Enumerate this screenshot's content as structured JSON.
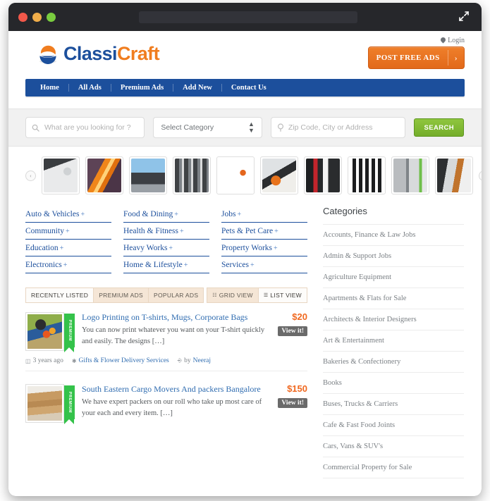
{
  "browser": {
    "traffic_lights": [
      "close",
      "minimize",
      "maximize"
    ],
    "url_value": "",
    "expand_icon": "expand-icon"
  },
  "header": {
    "login_label": "Login",
    "logo_part1": "Classi",
    "logo_part2": "Craft",
    "post_button_label": "POST FREE ADS",
    "post_button_chevron": "›",
    "brand_blue": "#1c4f9c",
    "brand_orange": "#f07d1f"
  },
  "nav": {
    "items": [
      {
        "label": "Home"
      },
      {
        "label": "All Ads"
      },
      {
        "label": "Premium Ads"
      },
      {
        "label": "Add New"
      },
      {
        "label": "Contact Us"
      }
    ]
  },
  "search": {
    "keyword_placeholder": "What are you looking for ?",
    "keyword_value": "",
    "category_selected": "Select Category",
    "location_placeholder": "Zip Code, City or Address",
    "location_value": "",
    "search_button_label": "SEARCH",
    "search_button_color": "#8fc63e"
  },
  "carousel": {
    "prev_label": "‹",
    "next_label": "›",
    "thumbs": [
      {
        "name": "fan-heater"
      },
      {
        "name": "infrared-heater"
      },
      {
        "name": "solar-water-heater"
      },
      {
        "name": "water-storage-tanks"
      },
      {
        "name": "wall-mounted-heater"
      },
      {
        "name": "kitchen-appliance-mixer"
      },
      {
        "name": "blender-food-processor"
      },
      {
        "name": "small-appliances-set"
      },
      {
        "name": "refrigerators"
      },
      {
        "name": "appliance-store"
      }
    ]
  },
  "category_links": [
    {
      "label": "Auto & Vehicles",
      "plus": "+"
    },
    {
      "label": "Food & Dining",
      "plus": "+"
    },
    {
      "label": "Jobs",
      "plus": "+"
    },
    {
      "label": "Community",
      "plus": "+"
    },
    {
      "label": "Health & Fitness",
      "plus": "+"
    },
    {
      "label": "Pets & Pet Care",
      "plus": "+"
    },
    {
      "label": "Education",
      "plus": "+"
    },
    {
      "label": "Heavy Works",
      "plus": "+"
    },
    {
      "label": "Property Works",
      "plus": "+"
    },
    {
      "label": "Electronics",
      "plus": "+"
    },
    {
      "label": "Home & Lifestyle",
      "plus": "+"
    },
    {
      "label": "Services",
      "plus": "+"
    }
  ],
  "tabs": [
    {
      "label": "RECENTLY LISTED",
      "active": true
    },
    {
      "label": "PREMIUM ADS",
      "active": false
    },
    {
      "label": "POPULAR ADS",
      "active": false
    }
  ],
  "views": [
    {
      "label": "GRID VIEW",
      "active": false,
      "glyph": "☷"
    },
    {
      "label": "LIST VIEW",
      "active": true,
      "glyph": "☰"
    }
  ],
  "listings": [
    {
      "badge": "PREMIUM",
      "title": "Logo Printing on T-shirts, Mugs, Corporate Bags",
      "description": "You can now print whatever you want on your T-shirt quickly and easily. The designs […]",
      "price": "$20",
      "view_label": "View it!",
      "time_ago": "3 years ago",
      "category": "Gifts & Flower Delivery Services",
      "author_prefix": "by",
      "author": "Neeraj",
      "image_name": "man-holding-flower-bouquet"
    },
    {
      "badge": "PREMIUM",
      "title": "South Eastern Cargo Movers And packers Bangalore",
      "description": "We have expert packers on our roll who take up most care of your each and every item. […]",
      "price": "$150",
      "view_label": "View it!",
      "image_name": "cardboard-moving-boxes"
    }
  ],
  "sidebar": {
    "title": "Categories",
    "items": [
      {
        "label": "Accounts, Finance & Law Jobs"
      },
      {
        "label": "Admin & Support Jobs"
      },
      {
        "label": "Agriculture Equipment"
      },
      {
        "label": "Apartments & Flats for Sale"
      },
      {
        "label": "Architects & Interior Designers"
      },
      {
        "label": "Art & Entertainment"
      },
      {
        "label": "Bakeries & Confectionery"
      },
      {
        "label": "Books"
      },
      {
        "label": "Buses, Trucks & Carriers"
      },
      {
        "label": "Cafe & Fast Food Joints"
      },
      {
        "label": "Cars, Vans & SUV's"
      },
      {
        "label": "Commercial Property for Sale"
      }
    ]
  }
}
